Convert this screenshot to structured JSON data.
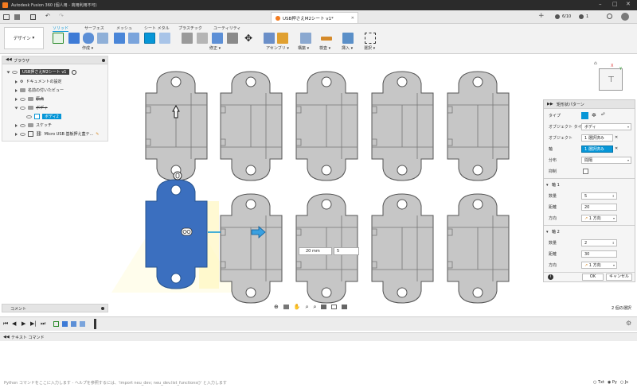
{
  "titlebar": {
    "app_title": "Autodesk Fusion 360 (個人用 - 商用利用不可)"
  },
  "tabbar": {
    "doc_tab": "USB押さえM2シート v1*",
    "job_count": "6/10",
    "notif_count": "1"
  },
  "ribbon": {
    "workspace": "デザイン",
    "tabs": [
      "ソリッド",
      "サーフェス",
      "メッシュ",
      "シート メタル",
      "プラスチック",
      "ユーティリティ"
    ],
    "groups": [
      "作成",
      "修正",
      "アセンブリ",
      "構築",
      "検査",
      "挿入",
      "選択"
    ]
  },
  "browser": {
    "header": "ブラウザ",
    "root": "USB押さえM2シート v1",
    "items": [
      "ドキュメントの設定",
      "名前の付いたビュー",
      "原点",
      "ボディ",
      "ボディ2",
      "スケッチ",
      "Micro USB 基板押え蓋テ..."
    ]
  },
  "canvas": {
    "field_distance": "20 mm",
    "field_count": "5"
  },
  "dialog": {
    "title": "矩形状パターン",
    "type_label": "タイプ",
    "type_value": "ボディ",
    "object_type_label": "オブジェクト タイプ",
    "object_label": "オブジェクト",
    "object_value": "1 選択済み",
    "axis_label": "軸",
    "axis_value": "1 選択済み",
    "distribution_label": "分布",
    "distribution_value": "間隔",
    "suppress_label": "抑制",
    "axis1_title": "軸 1",
    "qty_label": "数量",
    "distance_label": "距離",
    "direction_label": "方向",
    "axis1_qty": "5",
    "axis1_distance": "20",
    "axis1_direction": "1 方向",
    "axis2_title": "軸 2",
    "axis2_qty": "2",
    "axis2_distance": "30",
    "axis2_direction": "1 方向",
    "ok": "OK",
    "cancel": "キャンセル"
  },
  "status": {
    "comments": "コメント",
    "selection_count": "2 個の選択"
  },
  "command": {
    "header": "テキスト コマンド",
    "placeholder": "Python コマンドをここに入力します - ヘルプを参照するには、'import neu_dev; neu_dev.list_functions()' と入力します",
    "modes": [
      "Txt",
      "Py",
      "Js"
    ]
  },
  "colors": {
    "accent": "#0696d7",
    "selection_blue": "#3b6fbf",
    "part_gray": "#c6c6c6",
    "titlebar": "#2b2b2b"
  }
}
